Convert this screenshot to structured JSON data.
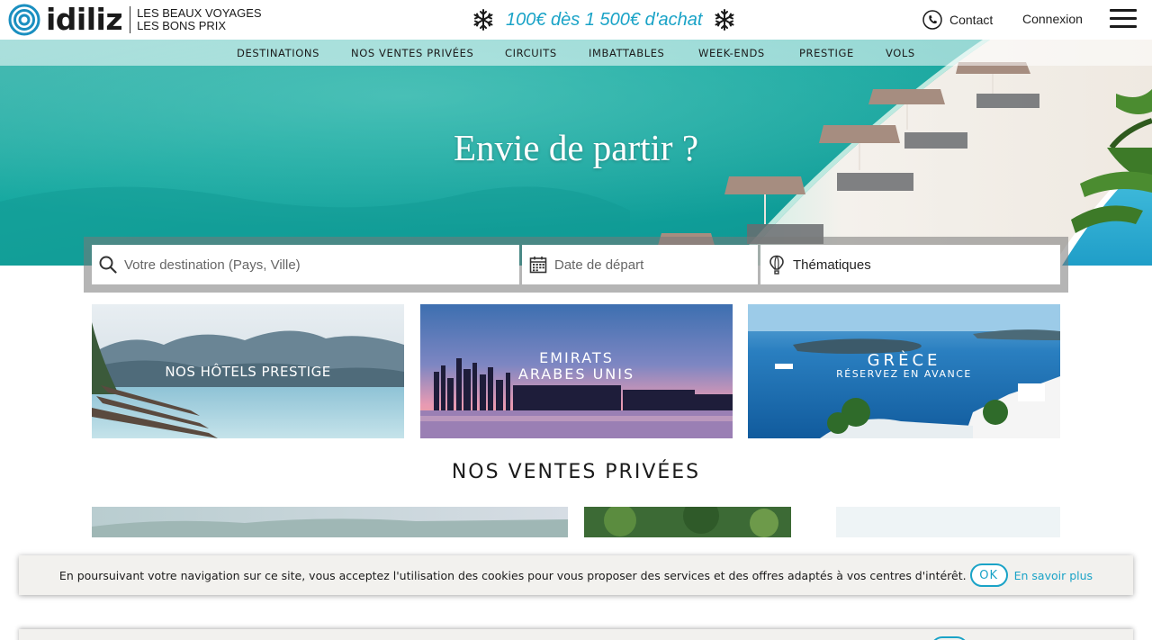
{
  "header": {
    "logo_text": "idiliz",
    "tagline_line1": "LES BEAUX VOYAGES",
    "tagline_line2": "LES BONS PRIX",
    "promo_text": "100€ dès 1 500€ d'achat",
    "contact_label": "Contact",
    "login_label": "Connexion",
    "menu_icon": "hamburger-menu-icon"
  },
  "nav": {
    "items": [
      {
        "label": "DESTINATIONS"
      },
      {
        "label": "NOS VENTES PRIVÉES"
      },
      {
        "label": "CIRCUITS"
      },
      {
        "label": "IMBATTABLES"
      },
      {
        "label": "WEEK-ENDS"
      },
      {
        "label": "PRESTIGE"
      },
      {
        "label": "VOLS"
      }
    ]
  },
  "hero": {
    "title": "Envie de partir ?"
  },
  "search": {
    "destination_placeholder": "Votre destination (Pays, Ville)",
    "date_placeholder": "Date de départ",
    "theme_label": "Thématiques"
  },
  "cards": [
    {
      "line1": "NOS HÔTELS PRESTIGE"
    },
    {
      "line1": "EMIRATS",
      "line2": "ARABES UNIS"
    },
    {
      "line1": "GRÈCE",
      "line2": "RÉSERVEZ EN AVANCE"
    }
  ],
  "sales": {
    "section_title": "NOS VENTES PRIVÉES"
  },
  "cookie": {
    "text": "En poursuivant votre navigation sur ce site, vous acceptez l'utilisation des cookies pour vous proposer des services et des offres adaptés à vos centres d'intérêt.",
    "ok_label": "OK",
    "more_label": "En savoir plus"
  },
  "colors": {
    "accent": "#1aa3c7",
    "text": "#1b1b1b",
    "cookie_bg": "#f2f1ee"
  }
}
